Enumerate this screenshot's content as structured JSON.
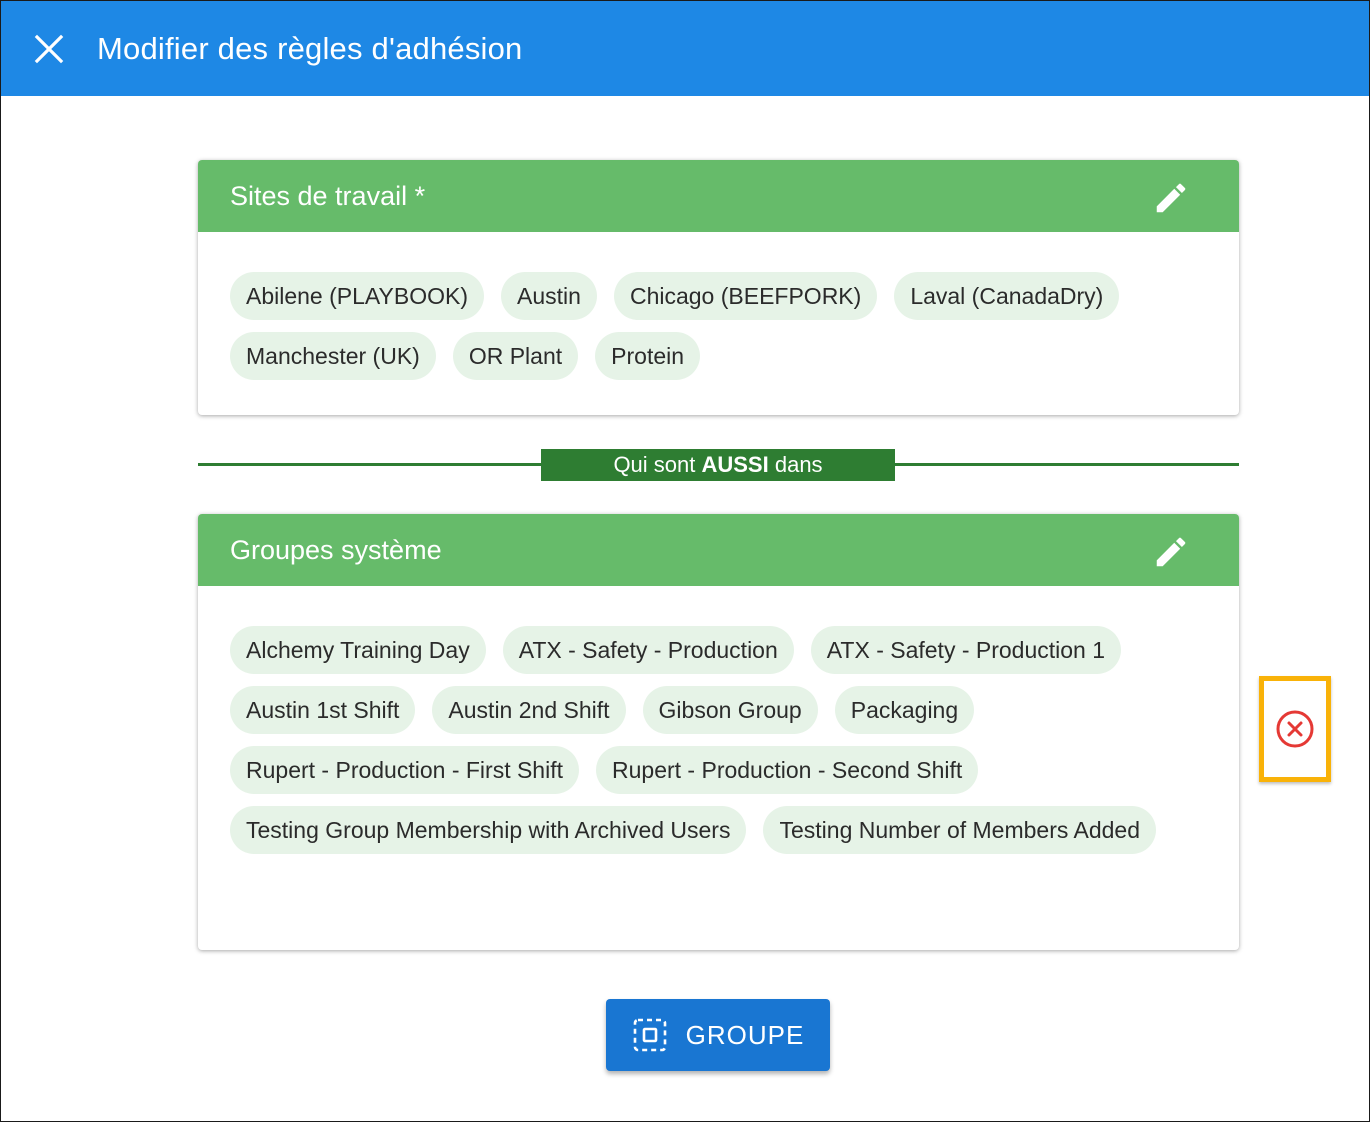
{
  "header": {
    "title": "Modifier des règles d'adhésion",
    "close_icon": "close-icon",
    "color": "#1e88e5"
  },
  "worksites": {
    "title": "Sites de travail *",
    "edit_icon": "pencil-icon",
    "chips": [
      "Abilene (PLAYBOOK)",
      "Austin",
      "Chicago (BEEFPORK)",
      "Laval (CanadaDry)",
      "Manchester (UK)",
      "OR Plant",
      "Protein"
    ]
  },
  "connector": {
    "prefix": "Qui sont ",
    "emphasis": "AUSSI",
    "suffix": " dans"
  },
  "system_groups": {
    "title": "Groupes système",
    "edit_icon": "pencil-icon",
    "chips": [
      "Alchemy Training Day",
      "ATX - Safety - Production",
      "ATX - Safety - Production 1",
      "Austin 1st Shift",
      "Austin 2nd Shift",
      "Gibson Group",
      "Packaging",
      "Rupert - Production - First Shift",
      "Rupert - Production - Second Shift",
      "Testing Group Membership with Archived Users",
      "Testing Number of Members Added"
    ],
    "remove_icon": "remove-circle-icon"
  },
  "actions": {
    "group_button_label": "GROUPE",
    "group_button_icon": "group-select-icon"
  },
  "colors": {
    "card_header": "#66bb6a",
    "chip_bg": "#e6f3e7",
    "connector": "#2e7d32",
    "highlight": "#f9b208",
    "remove": "#e53935",
    "button": "#1976d2"
  }
}
